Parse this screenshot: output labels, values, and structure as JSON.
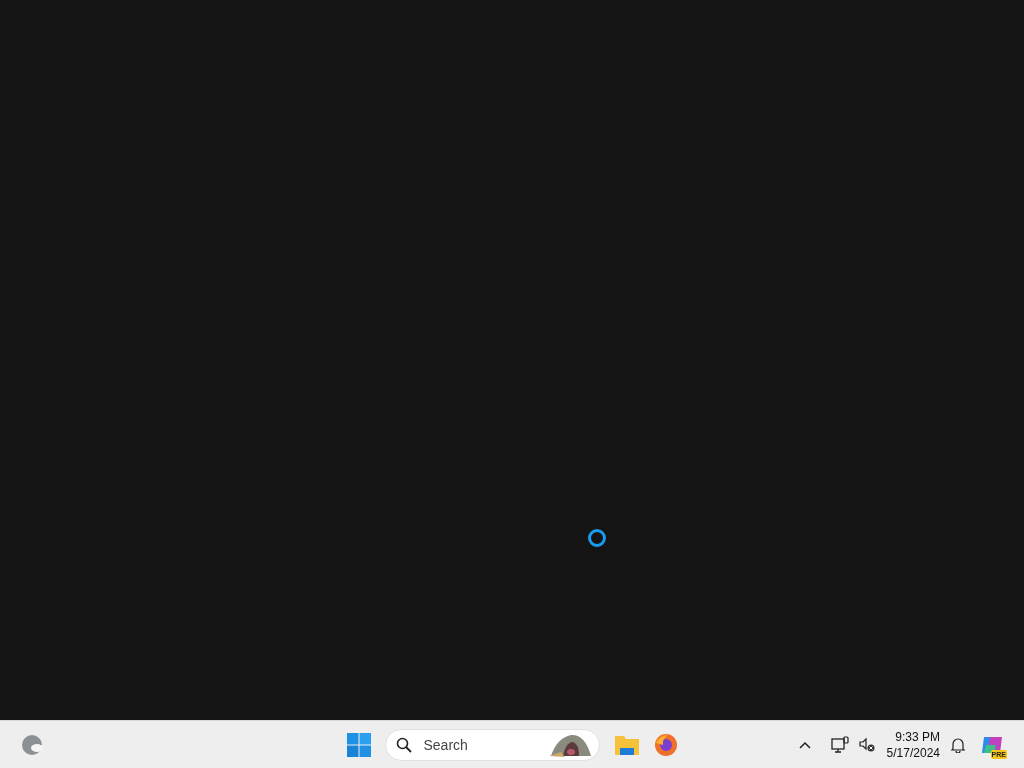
{
  "desktop": {
    "loading": true
  },
  "taskbar": {
    "search": {
      "placeholder": "Search"
    },
    "clock": {
      "time": "9:33 PM",
      "date": "5/17/2024"
    },
    "copilot_badge": "PRE"
  }
}
